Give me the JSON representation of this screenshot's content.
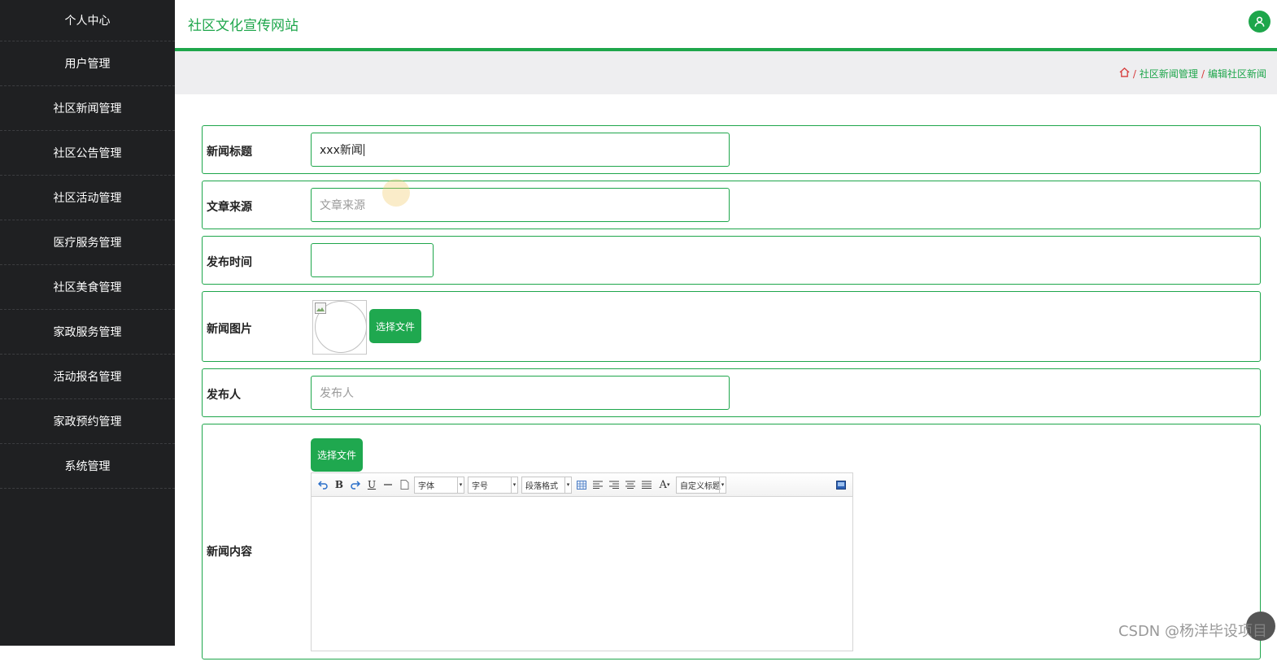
{
  "sidebar": {
    "items": [
      {
        "label": "个人中心"
      },
      {
        "label": "用户管理"
      },
      {
        "label": "社区新闻管理"
      },
      {
        "label": "社区公告管理"
      },
      {
        "label": "社区活动管理"
      },
      {
        "label": "医疗服务管理"
      },
      {
        "label": "社区美食管理"
      },
      {
        "label": "家政服务管理"
      },
      {
        "label": "活动报名管理"
      },
      {
        "label": "家政预约管理"
      },
      {
        "label": "系统管理"
      }
    ]
  },
  "header": {
    "title": "社区文化宣传网站",
    "avatar_icon": "user-icon"
  },
  "breadcrumb": {
    "home_icon": "home-icon",
    "separator": "/",
    "items": [
      "社区新闻管理",
      "编辑社区新闻"
    ]
  },
  "form": {
    "title": {
      "label": "新闻标题",
      "value": "xxx新闻"
    },
    "source": {
      "label": "文章来源",
      "placeholder": "文章来源"
    },
    "publish_time": {
      "label": "发布时间",
      "value": ""
    },
    "image": {
      "label": "新闻图片",
      "button": "选择文件"
    },
    "publisher": {
      "label": "发布人",
      "placeholder": "发布人"
    },
    "content": {
      "label": "新闻内容",
      "button": "选择文件",
      "toolbar": {
        "font": "字体",
        "size": "字号",
        "paragraph": "段落格式",
        "custom_title": "自定义标题"
      }
    }
  },
  "watermark": "CSDN @杨洋毕设项目",
  "colors": {
    "accent": "#1ea64b",
    "sidebar": "#1f2022",
    "breadcrumb_bg": "#eeeef0"
  }
}
